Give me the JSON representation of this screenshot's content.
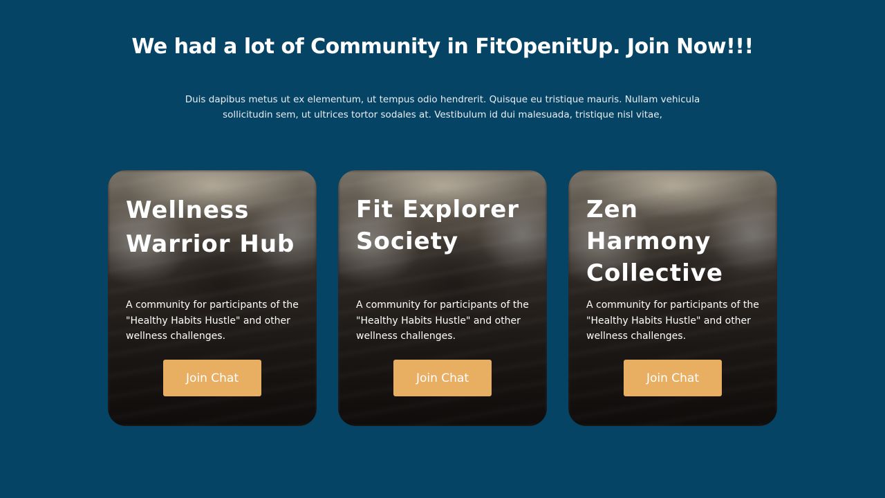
{
  "header": {
    "title": "We had a lot of Community in FitOpenitUp. Join Now!!!",
    "description": "Duis dapibus metus ut ex elementum, ut tempus odio hendrerit. Quisque eu tristique mauris. Nullam vehicula sollicitudin sem, ut ultrices tortor sodales at. Vestibulum id dui malesuada, tristique nisl vitae,"
  },
  "cards": [
    {
      "title": "Wellness Warrior Hub",
      "description": "A community for participants of the \"Healthy Habits Hustle\" and other wellness challenges.",
      "button_label": "Join Chat"
    },
    {
      "title": "Fit Explorer Society",
      "description": "A community for participants of the \"Healthy Habits Hustle\" and other wellness challenges.",
      "button_label": "Join Chat"
    },
    {
      "title": "Zen Harmony Collective",
      "description": "A community for participants of the \"Healthy Habits Hustle\" and other wellness challenges.",
      "button_label": "Join Chat"
    }
  ],
  "colors": {
    "background": "#064466",
    "button": "#e8ae62",
    "text": "#ffffff"
  }
}
